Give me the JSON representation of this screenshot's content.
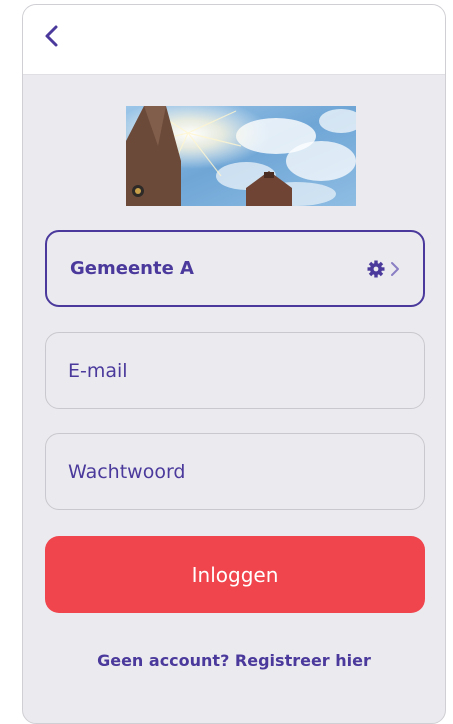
{
  "header": {
    "back_icon": "chevron-left-icon"
  },
  "hero": {
    "image": "church-tower-sun-sky-photo"
  },
  "municipality": {
    "name": "Gemeente A",
    "settings_icon": "gear-icon",
    "chevron_icon": "chevron-right-icon"
  },
  "form": {
    "email_placeholder": "E-mail",
    "password_placeholder": "Wachtwoord",
    "login_label": "Inloggen"
  },
  "register": {
    "link_label": "Geen account? Registreer hier"
  },
  "colors": {
    "accent": "#4b3a9c",
    "button": "#f0454d",
    "background": "#ebebef"
  }
}
